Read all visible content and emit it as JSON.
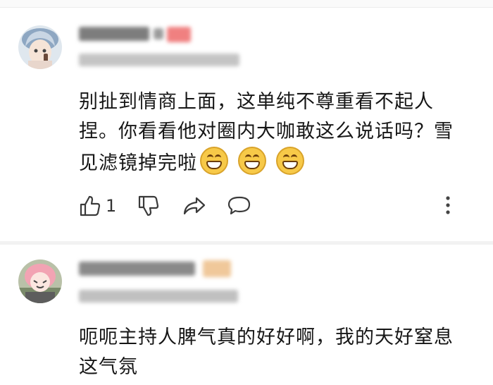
{
  "comments": [
    {
      "text_lines": [
        "别扯到情商上面，这单纯不尊重看不起人",
        "捏。你看看他对圈内大咖敢这么说话吗？雪",
        "见滤镜掉完啦"
      ],
      "emojis": [
        "grin-emoji",
        "grin-emoji",
        "grin-emoji"
      ],
      "like_count": "1"
    },
    {
      "text_lines": [
        "呃呃主持人脾气真的好好啊，我的天好窒息",
        "这气氛"
      ]
    }
  ],
  "icons": {
    "like": "thumbs-up-icon",
    "dislike": "thumbs-down-icon",
    "share": "share-icon",
    "reply": "comment-icon",
    "more": "more-vertical-icon"
  },
  "colors": {
    "redacted_name_accent": "#f08080",
    "emoji_yellow": "#f7c948"
  }
}
